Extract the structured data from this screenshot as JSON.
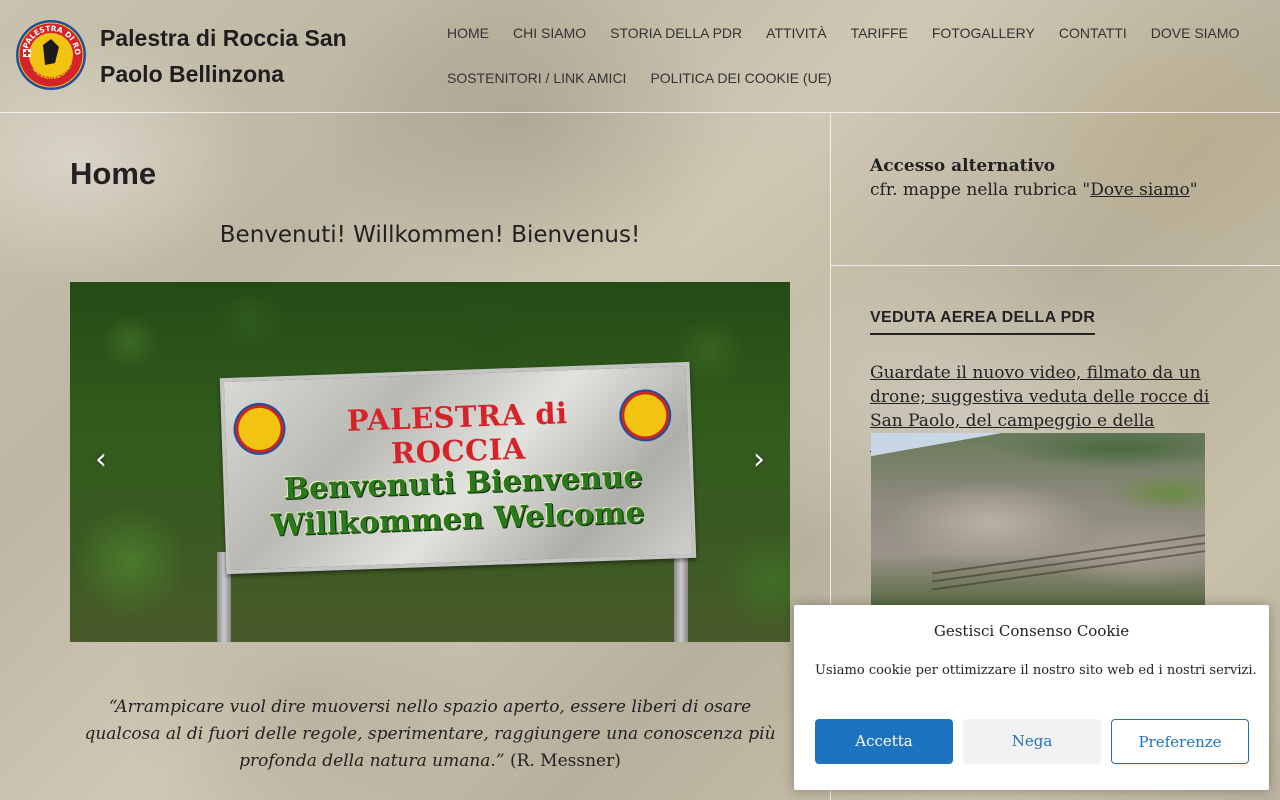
{
  "site": {
    "title": "Palestra di Roccia San Paolo Bellinzona",
    "logo_icon": "club-badge-logo",
    "logo_text": "PALESTRA DI ROCCIA BELLINZONA"
  },
  "nav": {
    "items": [
      {
        "label": "HOME"
      },
      {
        "label": "CHI SIAMO"
      },
      {
        "label": "STORIA DELLA PDR"
      },
      {
        "label": "ATTIVITÀ"
      },
      {
        "label": "TARIFFE"
      },
      {
        "label": "FOTOGALLERY"
      },
      {
        "label": "CONTATTI"
      },
      {
        "label": "DOVE SIAMO"
      },
      {
        "label": "SOSTENITORI / LINK AMICI"
      },
      {
        "label": "POLITICA DEI COOKIE (UE)"
      }
    ]
  },
  "main": {
    "page_title": "Home",
    "welcome": "Benvenuti! Willkommen! Bienvenus!",
    "slider": {
      "sign_title": "PALESTRA di ROCCIA",
      "sign_line1": "Benvenuti  Bienvenue",
      "sign_line2": "Willkommen   Welcome",
      "prev_icon": "chevron-left-icon",
      "next_icon": "chevron-right-icon"
    },
    "quote_text": "“Arrampicare vuol dire muoversi nello spazio aperto, essere liberi di osare qualcosa al di fuori delle regole, sperimentare, raggiungere una conoscenza più profonda della natura umana.”",
    "quote_author": "(R. Messner)"
  },
  "sidebar": {
    "access_title": "Accesso alternativo",
    "access_text": "cfr. mappe nella rubrica \"",
    "access_link": "Dove siamo",
    "access_suffix": "\"",
    "widget_title": "VEDUTA AEREA DELLA PDR",
    "widget_text": "Guardate il nuovo video, filmato da un drone; suggestiva veduta delle rocce di San Paolo, del campeggio e della capanna."
  },
  "cookie": {
    "title": "Gestisci Consenso Cookie",
    "text": "Usiamo cookie per ottimizzare il nostro sito web ed i nostri servizi.",
    "accept_label": "Accetta",
    "deny_label": "Nega",
    "prefs_label": "Preferenze",
    "accent_color": "#1e73be"
  }
}
